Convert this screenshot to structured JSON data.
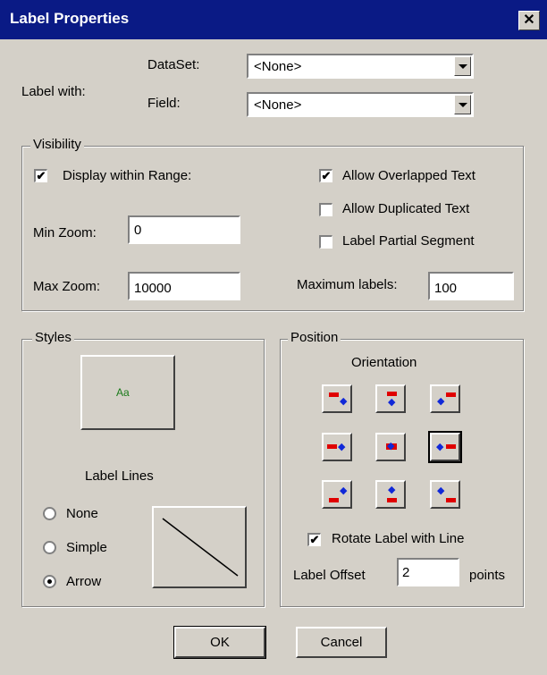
{
  "dialog": {
    "title": "Label Properties",
    "close_glyph": "✕"
  },
  "label_with": {
    "label": "Label with:",
    "dataset_label": "DataSet:",
    "dataset_value": "<None>",
    "field_label": "Field:",
    "field_value": "<None>"
  },
  "visibility": {
    "legend": "Visibility",
    "display_within_range": {
      "label": "Display within Range:",
      "checked": true
    },
    "min_zoom_label": "Min Zoom:",
    "min_zoom_value": "0",
    "max_zoom_label": "Max Zoom:",
    "max_zoom_value": "10000",
    "allow_overlapped": {
      "label": "Allow Overlapped Text",
      "checked": true
    },
    "allow_duplicated": {
      "label": "Allow Duplicated Text",
      "checked": false
    },
    "label_partial": {
      "label": "Label Partial Segment",
      "checked": false
    },
    "maximum_labels_label": "Maximum labels:",
    "maximum_labels_value": "100"
  },
  "styles": {
    "legend": "Styles",
    "font_sample": "Aa",
    "label_lines_label": "Label Lines",
    "options": [
      {
        "label": "None",
        "selected": false
      },
      {
        "label": "Simple",
        "selected": false
      },
      {
        "label": "Arrow",
        "selected": true
      }
    ]
  },
  "position": {
    "legend": "Position",
    "orientation_label": "Orientation",
    "selected_orientation": "right",
    "rotate": {
      "label": "Rotate Label with Line",
      "checked": true
    },
    "offset_label": "Label Offset",
    "offset_value": "2",
    "offset_unit": "points"
  },
  "buttons": {
    "ok": "OK",
    "cancel": "Cancel"
  },
  "colors": {
    "titlebar": "#0a1a85",
    "dialog_bg": "#d4d0c8",
    "marker_red": "#e00000",
    "marker_blue": "#1028d8"
  }
}
